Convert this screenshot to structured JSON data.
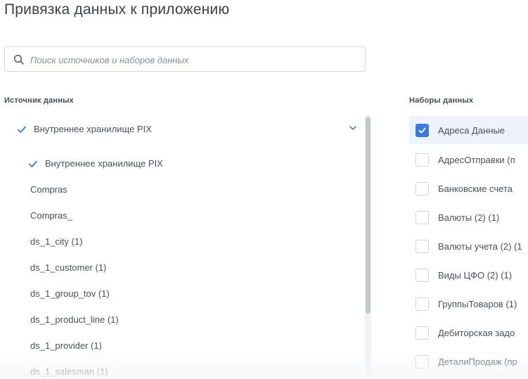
{
  "page": {
    "title": "Привязка данных к приложению"
  },
  "search": {
    "placeholder": "Поиск источников и наборов данных"
  },
  "sources": {
    "label": "Источник данных",
    "selected_group": "Внутреннее хранилище PIX",
    "items": [
      {
        "label": "Внутреннее хранилище PIX",
        "checked": true
      },
      {
        "label": "Compras",
        "checked": false
      },
      {
        "label": "Compras_",
        "checked": false
      },
      {
        "label": "ds_1_city (1)",
        "checked": false
      },
      {
        "label": "ds_1_customer (1)",
        "checked": false
      },
      {
        "label": "ds_1_group_tov (1)",
        "checked": false
      },
      {
        "label": "ds_1_product_line (1)",
        "checked": false
      },
      {
        "label": "ds_1_provider (1)",
        "checked": false
      },
      {
        "label": "ds_1_salesman (1)",
        "checked": false
      }
    ]
  },
  "datasets": {
    "label": "Наборы данных",
    "items": [
      {
        "label": "Адреса Данные",
        "checked": true
      },
      {
        "label": "АдресОтправки (п",
        "checked": false
      },
      {
        "label": "Банковские счета",
        "checked": false
      },
      {
        "label": "Валюты (2) (1)",
        "checked": false
      },
      {
        "label": "Валюты учета (2) (1",
        "checked": false
      },
      {
        "label": "Виды ЦФО (2) (1)",
        "checked": false
      },
      {
        "label": "ГруппыТоваров (1)",
        "checked": false
      },
      {
        "label": "Дебиторская задо",
        "checked": false
      },
      {
        "label": "ДеталиПродаж (пр",
        "checked": false
      }
    ]
  },
  "colors": {
    "accent": "#3a7bdc",
    "text": "#4a4f5a",
    "border": "#d3d6dc"
  }
}
